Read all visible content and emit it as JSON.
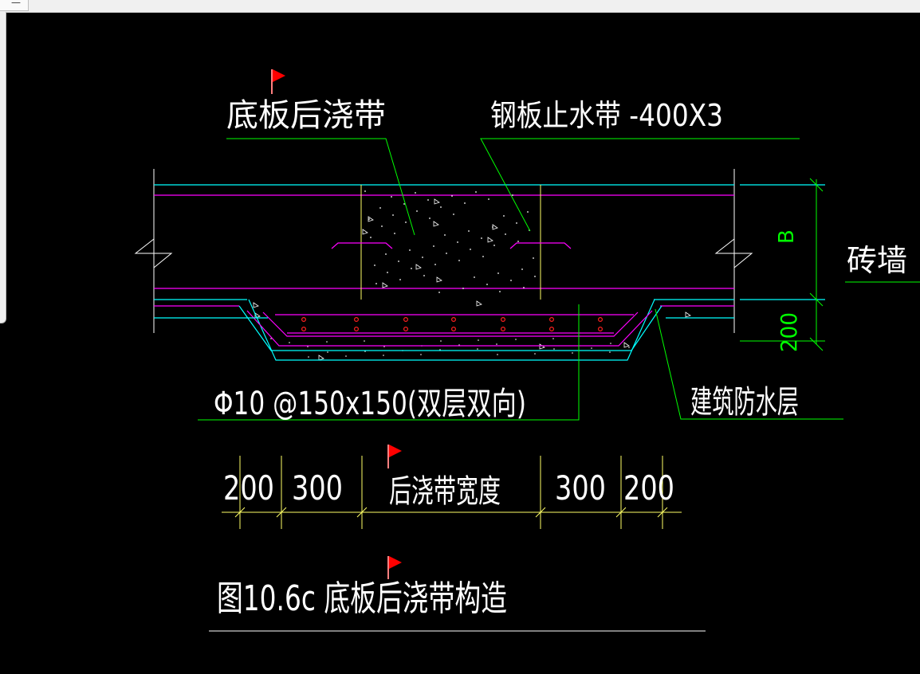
{
  "window": {
    "corner_glyph": "—"
  },
  "labels": {
    "slab_post_pour_strip": "底板后浇带",
    "steel_waterstop": "钢板止水带 -400X3",
    "dim_b": "B",
    "brick_wall": "砖墙",
    "dim_200_vertical": "200",
    "rebar_spec": "Φ10 @150x150(双层双向)",
    "waterproof_layer": "建筑防水层"
  },
  "dimensions": {
    "segments": [
      "200",
      "300",
      "后浇带宽度",
      "300",
      "200"
    ]
  },
  "caption": "图10.6c  底板后浇带构造",
  "colors": {
    "cyan": "#00ffff",
    "magenta": "#ff00ff",
    "yellow": "#ffff66",
    "green": "#00ff00",
    "white": "#ffffff",
    "red": "#ff2020",
    "flag": "#ff0000"
  }
}
